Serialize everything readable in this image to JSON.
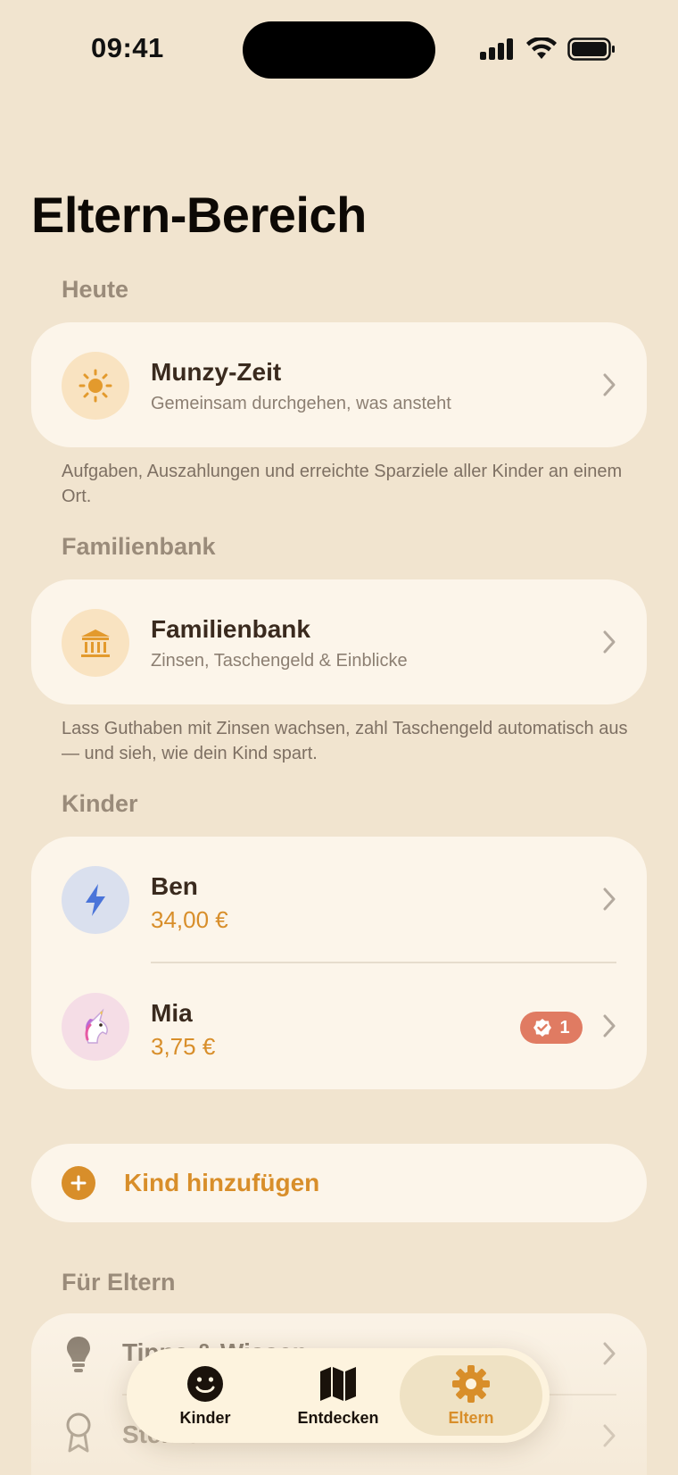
{
  "status_bar": {
    "time": "09:41"
  },
  "page_title": "Eltern-Bereich",
  "sections": {
    "today": {
      "header": "Heute",
      "item": {
        "title": "Munzy-Zeit",
        "subtitle": "Gemeinsam durchgehen, was ansteht",
        "icon": "sun-icon"
      },
      "footnote": "Aufgaben, Auszahlungen und erreichte Sparziele aller Kinder an einem Ort."
    },
    "family_bank": {
      "header": "Familienbank",
      "item": {
        "title": "Familienbank",
        "subtitle": "Zinsen, Taschengeld & Einblicke",
        "icon": "bank-icon"
      },
      "footnote": "Lass Guthaben mit Zinsen wachsen, zahl Taschengeld automatisch aus — und sieh, wie dein Kind spart."
    },
    "children": {
      "header": "Kinder",
      "items": [
        {
          "name": "Ben",
          "amount": "34,00 €",
          "icon": "lightning-icon"
        },
        {
          "name": "Mia",
          "amount": "3,75 €",
          "icon": "unicorn-icon",
          "badge": "1"
        }
      ],
      "add_label": "Kind hinzufügen"
    },
    "for_parents": {
      "header": "Für Eltern",
      "items": [
        {
          "label": "Tipps & Wissen",
          "icon": "lightbulb-icon"
        },
        {
          "label": "Sterne",
          "icon": "award-icon"
        }
      ]
    }
  },
  "tab_bar": {
    "tabs": [
      {
        "label": "Kinder",
        "icon": "smiley-icon"
      },
      {
        "label": "Entdecken",
        "icon": "map-icon"
      },
      {
        "label": "Eltern",
        "icon": "gear-icon",
        "active": true
      }
    ]
  },
  "colors": {
    "background": "#F1E4CF",
    "card": "#FCF5EA",
    "accent": "#D88E2A",
    "badge": "#E07B62"
  }
}
